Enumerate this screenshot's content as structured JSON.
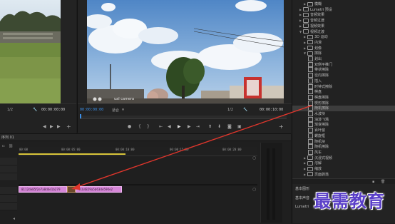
{
  "source_monitor": {
    "timecode": "00:00:00:00",
    "scale": "1/2"
  },
  "program_monitor": {
    "timecode_current": "00:00:00:00",
    "fit_label": "适合",
    "scale": "1/2",
    "timecode_total": "00:00:10:00",
    "video_overlay_text": "ual camera"
  },
  "effects_panel": {
    "items": [
      {
        "label": "模糊",
        "level": 2,
        "type": "folder",
        "expanded": false
      },
      {
        "label": "Lumetri 预设",
        "level": 1,
        "type": "folder",
        "expanded": false
      },
      {
        "label": "音频效果",
        "level": 1,
        "type": "folder",
        "expanded": false
      },
      {
        "label": "音频过渡",
        "level": 1,
        "type": "folder",
        "expanded": false
      },
      {
        "label": "视频效果",
        "level": 1,
        "type": "folder",
        "expanded": false
      },
      {
        "label": "视频过渡",
        "level": 1,
        "type": "folder",
        "expanded": true
      },
      {
        "label": "3D 运动",
        "level": 2,
        "type": "folder",
        "expanded": false
      },
      {
        "label": "内滑",
        "level": 2,
        "type": "folder",
        "expanded": false
      },
      {
        "label": "划像",
        "level": 2,
        "type": "folder",
        "expanded": false
      },
      {
        "label": "擦除",
        "level": 2,
        "type": "folder",
        "expanded": true
      },
      {
        "label": "划出",
        "level": 3,
        "type": "effect"
      },
      {
        "label": "双侧平推门",
        "level": 3,
        "type": "effect"
      },
      {
        "label": "带状擦除",
        "level": 3,
        "type": "effect"
      },
      {
        "label": "径向擦除",
        "level": 3,
        "type": "effect"
      },
      {
        "label": "插入",
        "level": 3,
        "type": "effect"
      },
      {
        "label": "时钟式擦除",
        "level": 3,
        "type": "effect"
      },
      {
        "label": "棋盘",
        "level": 3,
        "type": "effect"
      },
      {
        "label": "棋盘擦除",
        "level": 3,
        "type": "effect"
      },
      {
        "label": "楔形擦除",
        "level": 3,
        "type": "effect"
      },
      {
        "label": "随机擦除",
        "level": 3,
        "type": "effect",
        "selected": true
      },
      {
        "label": "水波块",
        "level": 3,
        "type": "effect"
      },
      {
        "label": "油漆飞溅",
        "level": 3,
        "type": "effect"
      },
      {
        "label": "渐变擦除",
        "level": 3,
        "type": "effect"
      },
      {
        "label": "百叶窗",
        "level": 3,
        "type": "effect"
      },
      {
        "label": "螺旋框",
        "level": 3,
        "type": "effect"
      },
      {
        "label": "随机块",
        "level": 3,
        "type": "effect"
      },
      {
        "label": "随机擦除",
        "level": 3,
        "type": "effect"
      },
      {
        "label": "风车",
        "level": 3,
        "type": "effect"
      },
      {
        "label": "沉浸式视频",
        "level": 2,
        "type": "folder",
        "expanded": false
      },
      {
        "label": "溶解",
        "level": 2,
        "type": "folder",
        "expanded": false
      },
      {
        "label": "缩放",
        "level": 2,
        "type": "folder",
        "expanded": false
      },
      {
        "label": "页面剥落",
        "level": 2,
        "type": "folder",
        "expanded": false
      }
    ],
    "footer_label_1": "基本图形",
    "footer_label_2": "基本声音",
    "footer_label_3": "Lumetri"
  },
  "timeline": {
    "tab": "序列 01",
    "ruler_labels": [
      "00:00",
      "00:00:05:00",
      "00:00:10:00",
      "00:00:15:00",
      "00:00:20:00"
    ],
    "clip_a_label": "8112de85f2e7a8d4e1b279",
    "clip_b_label": "91b4829a5b63de590e2"
  },
  "watermark": "最需教育",
  "colors": {
    "accent_blue": "#3c8fe6",
    "clip_pink": "#d687d8",
    "arrow_red": "#e0362c",
    "playhead_yellow": "#d8c53a"
  }
}
